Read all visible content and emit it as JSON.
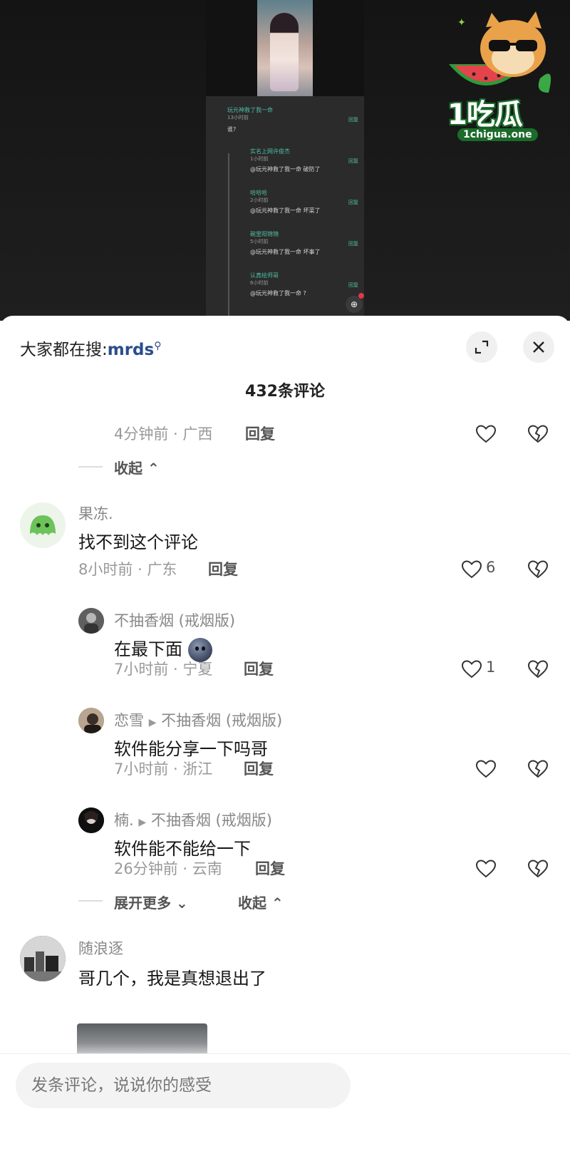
{
  "video": {
    "screenshot_comments": [
      {
        "name": "玩元神救了我一命",
        "time": "13小时前",
        "text": "谁?",
        "reply": "回复"
      },
      {
        "name": "实名上网许俊杰",
        "time": "1小时前",
        "text": "@玩元神救了我一命 破防了",
        "reply": "回复"
      },
      {
        "name": "哈哈哈",
        "time": "2小时前",
        "text": "@玩元神救了我一命 坏菜了",
        "reply": "回复"
      },
      {
        "name": "碗里阳锦锦",
        "time": "5小时前",
        "text": "@玩元神救了我一命 坏事了",
        "reply": "回复"
      },
      {
        "name": "认真绘师哥",
        "time": "6小时前",
        "text": "@玩元神救了我一命 ?",
        "reply": "回复"
      }
    ]
  },
  "watermark": {
    "logo_big": "1吃瓜",
    "logo_small": "1chigua.one",
    "accent": "#1b6b2a"
  },
  "header": {
    "search_prefix": "大家都在搜:",
    "search_keyword": "mrds",
    "search_icon": "search-icon",
    "expand_icon": "expand-icon",
    "close_icon": "close-icon",
    "comment_count_title": "432条评论"
  },
  "comments": {
    "top_partial": {
      "meta": "4分钟前 · 广西",
      "reply": "回复",
      "collapse": "收起"
    },
    "c1": {
      "user": "果冻.",
      "text": "找不到这个评论",
      "meta": "8小时前 · 广东",
      "reply": "回复",
      "likes": "6",
      "replies": [
        {
          "user": "不抽香烟 (戒烟版)",
          "reply_to": "",
          "text": "在最下面",
          "has_emoji": true,
          "meta": "7小时前 · 宁夏",
          "reply": "回复",
          "likes": "1"
        },
        {
          "user": "恋雪",
          "reply_to": "不抽香烟 (戒烟版)",
          "text": "软件能分享一下吗哥",
          "meta": "7小时前 · 浙江",
          "reply": "回复",
          "likes": ""
        },
        {
          "user": "楠.",
          "reply_to": "不抽香烟 (戒烟版)",
          "text": "软件能不能给一下",
          "meta": "26分钟前 · 云南",
          "reply": "回复",
          "likes": ""
        }
      ],
      "expand_more": "展开更多",
      "collapse": "收起"
    },
    "c2": {
      "user": "随浪逐",
      "text": "哥几个，我是真想退出了"
    }
  },
  "input": {
    "placeholder": "发条评论，说说你的感受"
  }
}
